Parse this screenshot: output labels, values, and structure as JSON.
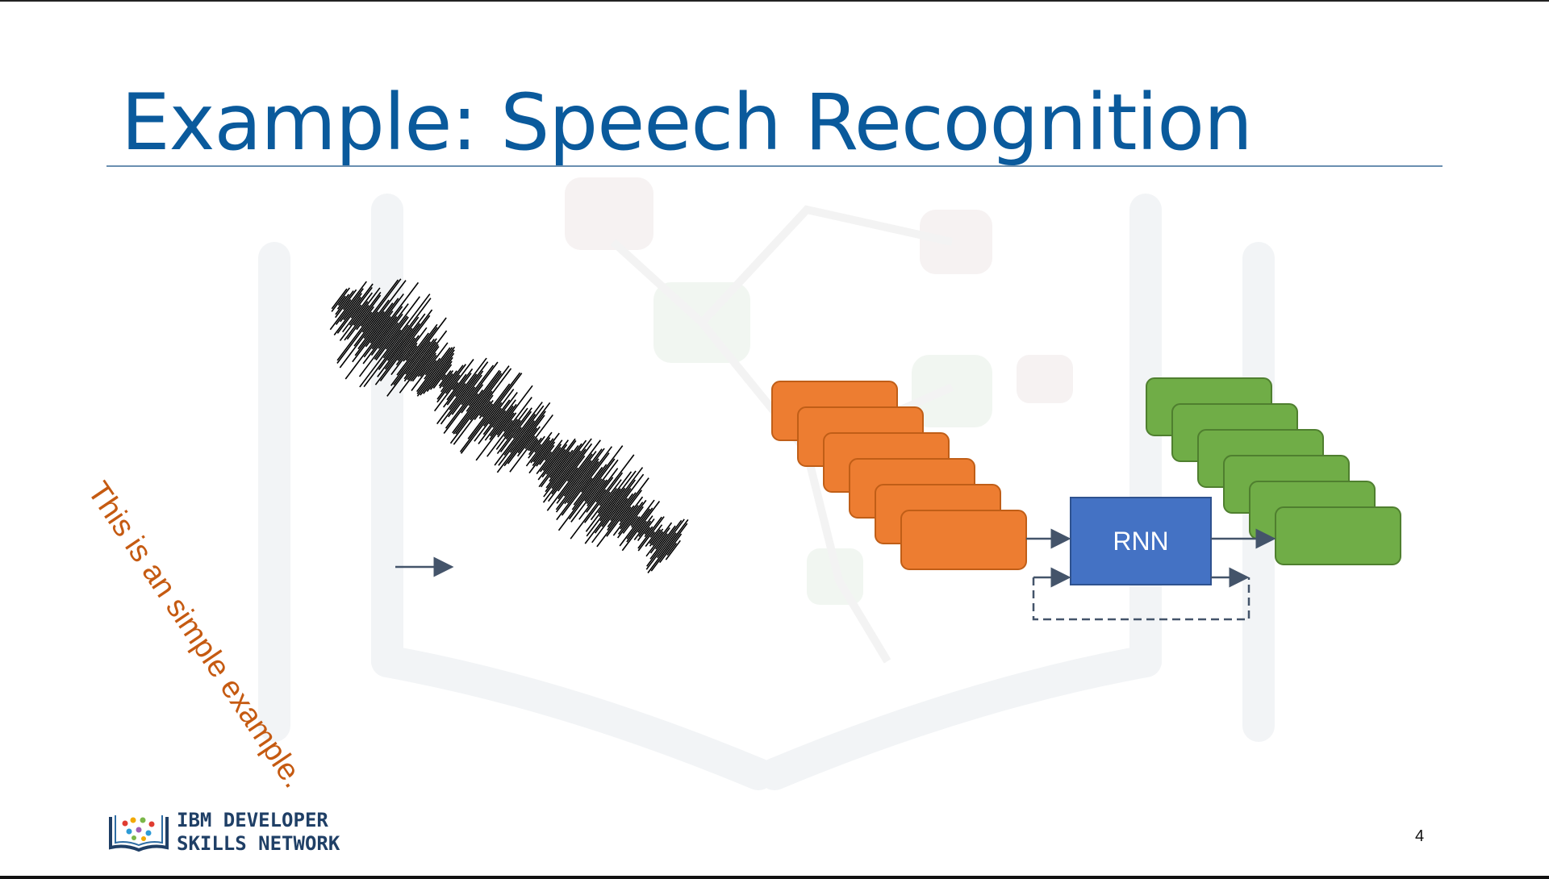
{
  "slide": {
    "title": "Example: Speech Recognition",
    "caption": "This is an simple example.",
    "rnn_label": "RNN",
    "page_number": "4",
    "logo": {
      "line1": "IBM DEVELOPER",
      "line2": "SKILLS NETWORK"
    }
  },
  "colors": {
    "title": "#0a5a9c",
    "caption": "#c55a11",
    "input_box": "#ed7d31",
    "rnn_box": "#4472c4",
    "output_box": "#70ad47",
    "arrow": "#44546a"
  },
  "icons": [
    "arrow-right-icon",
    "waveform-icon",
    "ibm-book-logo-icon"
  ]
}
